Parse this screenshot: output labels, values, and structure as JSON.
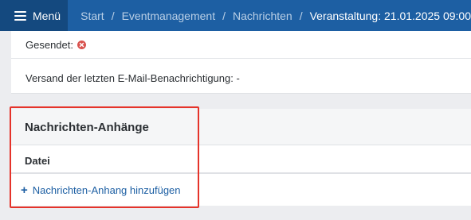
{
  "topbar": {
    "menu_label": "Menü",
    "breadcrumbs": [
      "Start",
      "Eventmanagement",
      "Nachrichten"
    ],
    "current": "Veranstaltung: 21.01.2025 09:00",
    "separator": "/",
    "background_color": "#1d5fa3"
  },
  "details": {
    "sent_label": "Gesendet:",
    "sent_status_icon": "error-x-icon",
    "last_email_label": "Versand der letzten E-Mail-Benachrichtigung: -"
  },
  "attachments": {
    "title": "Nachrichten-Anhänge",
    "column_file": "Datei",
    "add_label": "Nachrichten-Anhang hinzufügen",
    "add_icon": "plus-icon",
    "highlight_color": "#e5332a"
  }
}
